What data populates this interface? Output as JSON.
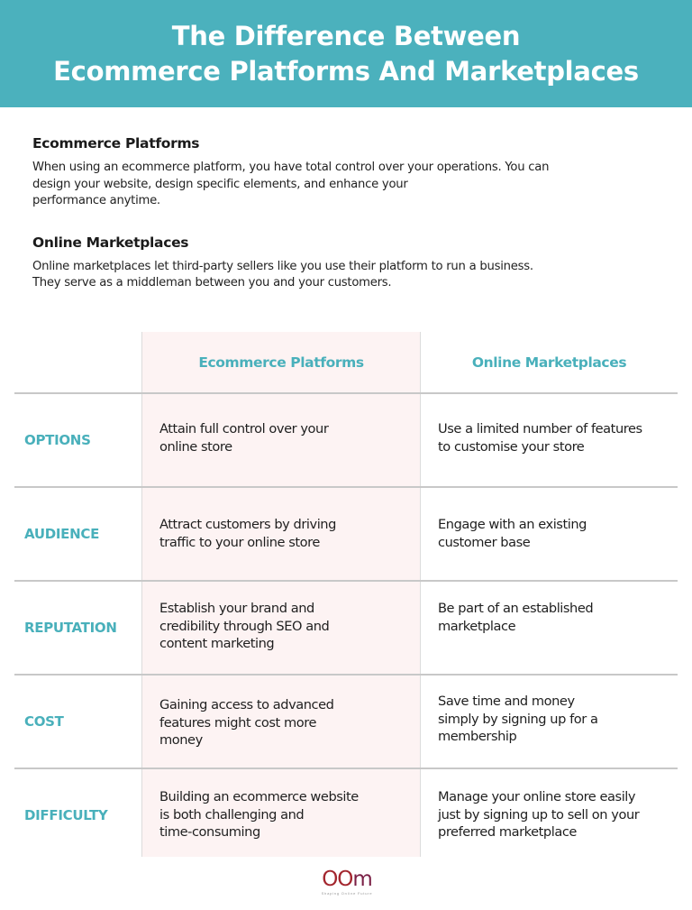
{
  "header": {
    "title_line1": "The Difference Between",
    "title_line2": "Ecommerce Platforms And Marketplaces",
    "background_color": "#4bb1bd"
  },
  "intro": [
    {
      "heading": "Ecommerce Platforms",
      "lines": [
        "When using an ecommerce platform, you have total control over your operations. You can",
        "design your website, design specific elements, and enhance your",
        "performance anytime."
      ]
    },
    {
      "heading": "Online Marketplaces",
      "lines": [
        "Online marketplaces let third-party sellers like you use their platform to run a business.",
        "They serve as a middleman between you and your customers."
      ]
    }
  ],
  "table": {
    "accent_color": "#49b0bb",
    "highlight_column_color": "#fdf3f3",
    "columns": [
      "",
      "Ecommerce Platforms",
      "Online Marketplaces"
    ],
    "rows": [
      {
        "label": "OPTIONS",
        "ecommerce": [
          "Attain full control over your",
          "online store"
        ],
        "marketplace": [
          "Use a limited number of features",
          "to customise your store"
        ]
      },
      {
        "label": "AUDIENCE",
        "ecommerce": [
          "Attract customers by driving",
          "traffic to your online store"
        ],
        "marketplace": [
          "Engage with an existing",
          "customer base"
        ]
      },
      {
        "label": "REPUTATION",
        "ecommerce": [
          "Establish your brand and",
          "credibility through SEO and",
          "content marketing"
        ],
        "marketplace": [
          "Be part of an established",
          "marketplace"
        ]
      },
      {
        "label": "COST",
        "ecommerce": [
          "Gaining access to advanced",
          "features might cost more",
          "money"
        ],
        "marketplace": [
          "Save time and money",
          "simply by signing up for a",
          "membership"
        ]
      },
      {
        "label": "DIFFICULTY",
        "ecommerce": [
          "Building an ecommerce website",
          "is both challenging and",
          "time-consuming"
        ],
        "marketplace": [
          "Manage your online store easily",
          "just by signing up to sell on your",
          "preferred marketplace"
        ]
      }
    ]
  },
  "footer": {
    "logo_oo": "OO",
    "logo_m": "m",
    "logo_tagline": "Shaping Online Future"
  }
}
